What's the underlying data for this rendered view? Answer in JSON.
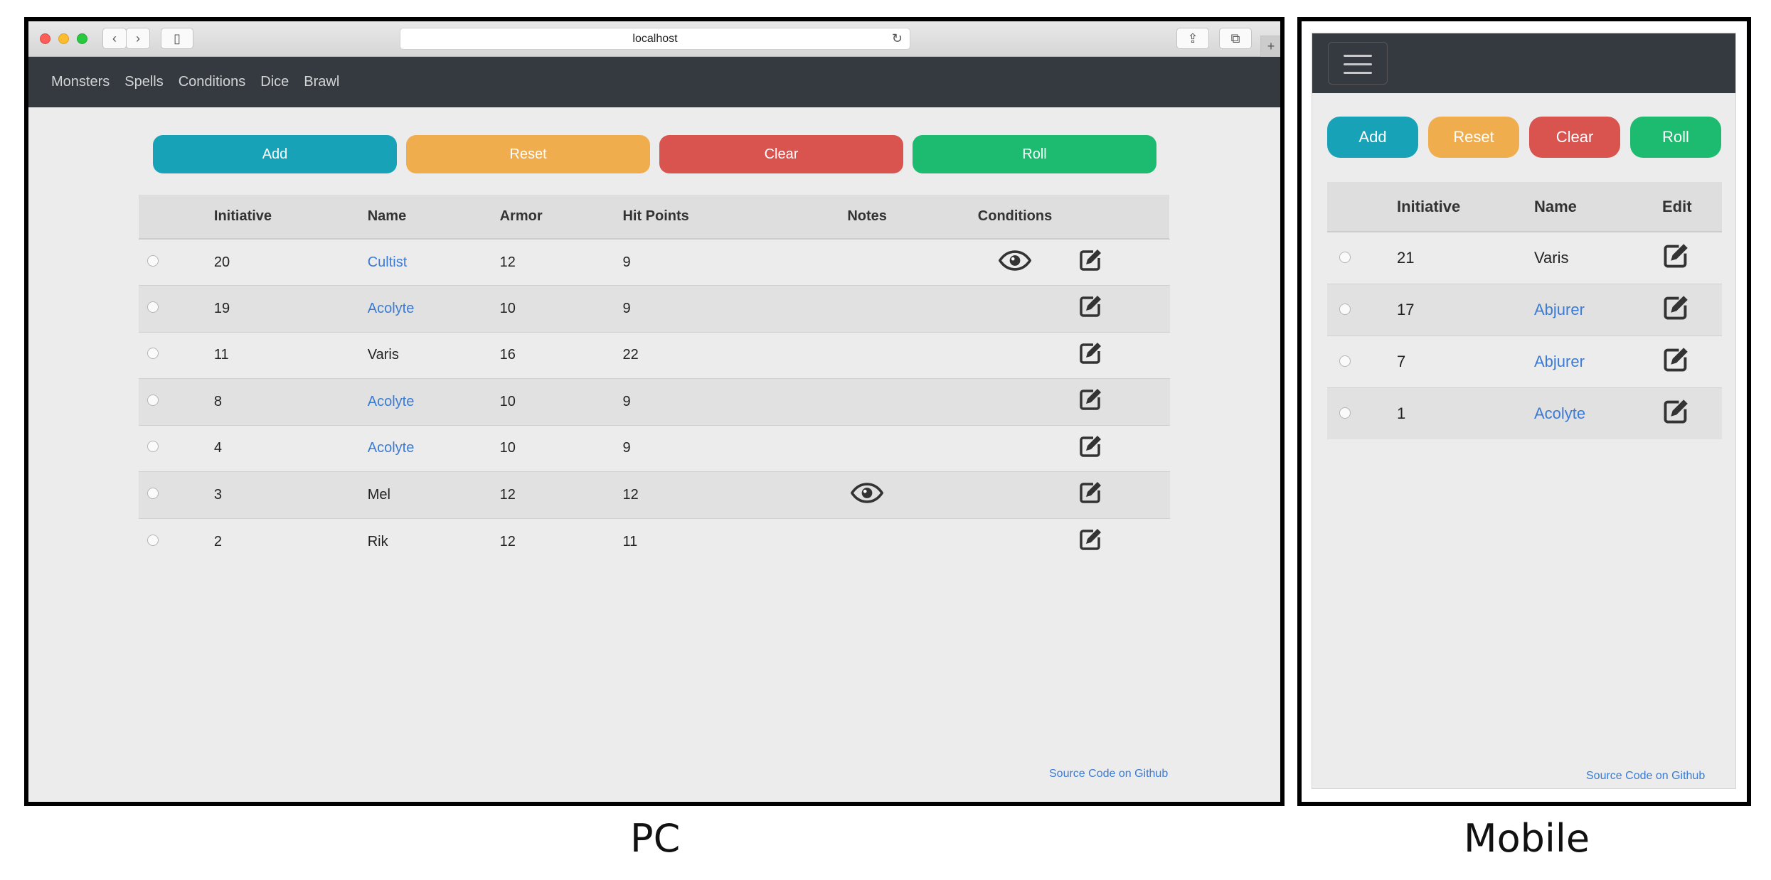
{
  "pc": {
    "address_url": "localhost",
    "nav": [
      "Monsters",
      "Spells",
      "Conditions",
      "Dice",
      "Brawl"
    ],
    "buttons": {
      "add": "Add",
      "reset": "Reset",
      "clear": "Clear",
      "roll": "Roll"
    },
    "columns": [
      "Initiative",
      "Name",
      "Armor",
      "Hit Points",
      "Notes",
      "Conditions",
      "Edit"
    ],
    "rows": [
      {
        "initiative": "20",
        "name": "Cultist",
        "link": true,
        "armor": "12",
        "hp": "9",
        "notes_icon": false,
        "conditions_icon": true
      },
      {
        "initiative": "19",
        "name": "Acolyte",
        "link": true,
        "armor": "10",
        "hp": "9",
        "notes_icon": false,
        "conditions_icon": false
      },
      {
        "initiative": "11",
        "name": "Varis",
        "link": false,
        "armor": "16",
        "hp": "22",
        "notes_icon": false,
        "conditions_icon": false
      },
      {
        "initiative": "8",
        "name": "Acolyte",
        "link": true,
        "armor": "10",
        "hp": "9",
        "notes_icon": false,
        "conditions_icon": false
      },
      {
        "initiative": "4",
        "name": "Acolyte",
        "link": true,
        "armor": "10",
        "hp": "9",
        "notes_icon": false,
        "conditions_icon": false
      },
      {
        "initiative": "3",
        "name": "Mel",
        "link": false,
        "armor": "12",
        "hp": "12",
        "notes_icon": true,
        "conditions_icon": false
      },
      {
        "initiative": "2",
        "name": "Rik",
        "link": false,
        "armor": "12",
        "hp": "11",
        "notes_icon": false,
        "conditions_icon": false
      }
    ],
    "source_link": "Source Code on Github"
  },
  "mobile": {
    "buttons": {
      "add": "Add",
      "reset": "Reset",
      "clear": "Clear",
      "roll": "Roll"
    },
    "columns": [
      "Initiative",
      "Name",
      "Edit"
    ],
    "rows": [
      {
        "initiative": "21",
        "name": "Varis",
        "link": false
      },
      {
        "initiative": "17",
        "name": "Abjurer",
        "link": true
      },
      {
        "initiative": "7",
        "name": "Abjurer",
        "link": true
      },
      {
        "initiative": "1",
        "name": "Acolyte",
        "link": true
      }
    ],
    "source_link": "Source Code on Github"
  },
  "captions": {
    "pc": "PC",
    "mobile": "Mobile"
  },
  "colors": {
    "navbar": "#343a40",
    "add": "#17a2b8",
    "reset": "#f0ad4e",
    "clear": "#d9534f",
    "roll": "#1cbb6f",
    "link": "#3a7bd5"
  },
  "icons": {
    "edit": "edit-icon",
    "view": "eye-icon",
    "menu": "hamburger-icon"
  }
}
